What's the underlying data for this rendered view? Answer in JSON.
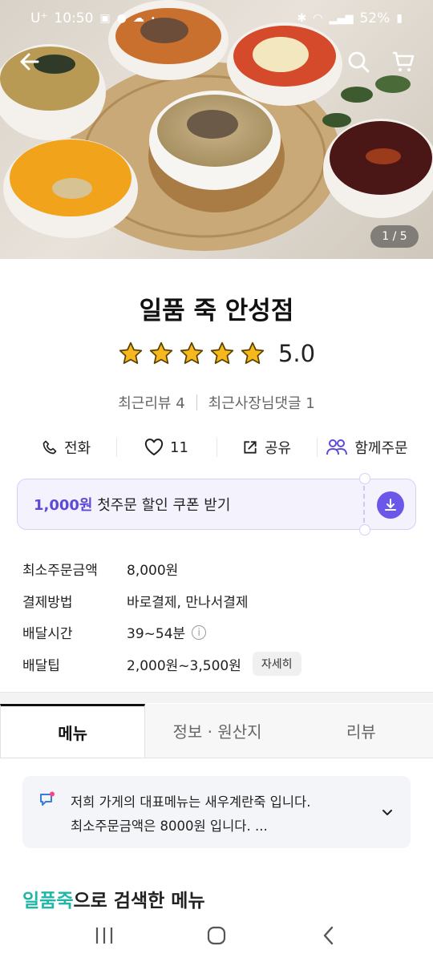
{
  "status_bar": {
    "carrier": "U⁺",
    "time": "10:50",
    "battery": "52%"
  },
  "hero": {
    "page_indicator": "1 / 5"
  },
  "store": {
    "name": "일품 죽 안성점",
    "rating_value": "5.0",
    "stars": 5,
    "recent_reviews": "최근리뷰 4",
    "owner_comments": "최근사장님댓글 1"
  },
  "actions": {
    "call": "전화",
    "like_count": "11",
    "share": "공유",
    "group_order": "함께주문"
  },
  "coupon": {
    "amount": "1,000원",
    "text": " 첫주문 할인 쿠폰 받기"
  },
  "info": {
    "rows": [
      {
        "label": "최소주문금액",
        "value": "8,000원"
      },
      {
        "label": "결제방법",
        "value": "바로결제, 만나서결제"
      },
      {
        "label": "배달시간",
        "value": "39~54분"
      },
      {
        "label": "배달팁",
        "value": "2,000원~3,500원"
      }
    ],
    "detail_button": "자세히"
  },
  "tabs": [
    "메뉴",
    "정보 · 원산지",
    "리뷰"
  ],
  "notice": {
    "line1": "저희 가게의 대표메뉴는 새우계란죽 입니다.",
    "line2": "최소주문금액은 8000원 입니다. ..."
  },
  "search_section": {
    "keyword": "일품죽",
    "suffix": "으로 검색한 메뉴"
  },
  "colors": {
    "accent_purple": "#6b57e8",
    "teal": "#1fb7a8",
    "star": "#f6b81d"
  },
  "icons": [
    "back-arrow-icon",
    "search-icon",
    "cart-icon",
    "phone-icon",
    "heart-icon",
    "share-icon",
    "group-icon",
    "download-icon",
    "info-icon",
    "notice-icon",
    "chevron-down-icon"
  ]
}
